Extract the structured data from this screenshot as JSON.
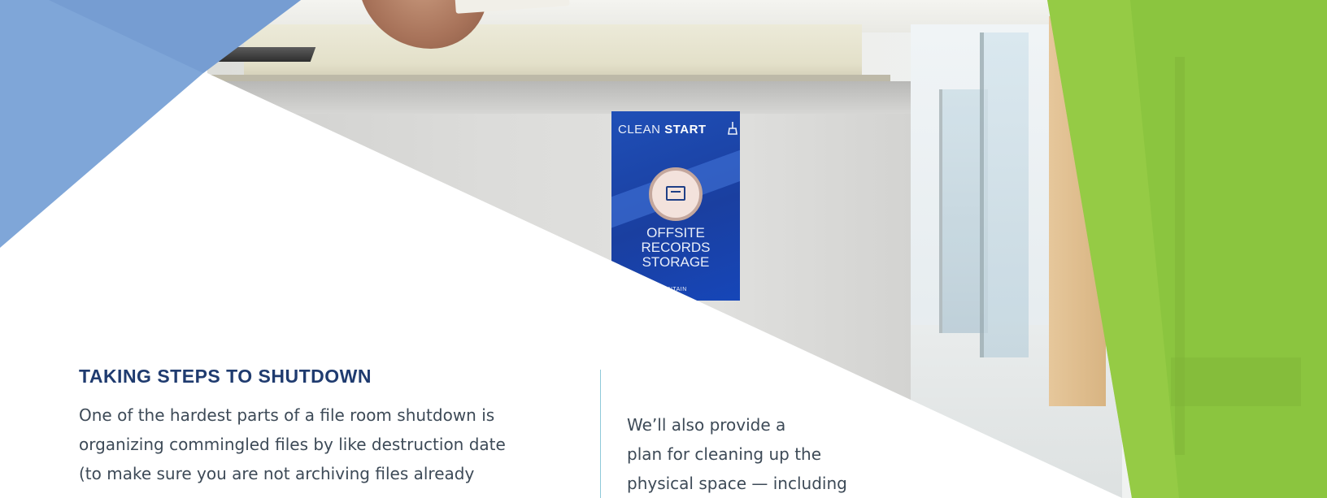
{
  "colors": {
    "heading": "#1f3b6f",
    "body": "#3d4a57",
    "accent_blue": "#6f9ad0",
    "accent_green": "#8bc53f",
    "divider": "#8fc9d9",
    "poster_blue": "#1f4fb7"
  },
  "photo": {
    "poster": {
      "brand_light": "CLEAN ",
      "brand_bold": "START",
      "icon": "broom-icon",
      "box_icon": "archive-box-icon",
      "title_lines": [
        "OFFSITE",
        "RECORDS",
        "STORAGE"
      ],
      "footer": "IRON MOUNTAIN"
    }
  },
  "section": {
    "heading": "TAKING STEPS TO SHUTDOWN",
    "left_lines": [
      "One of the hardest parts of a file room shutdown is",
      "organizing commingled files by like destruction date",
      "(to make sure you are not archiving files already"
    ],
    "right_lines": [
      "We’ll also provide a",
      "plan for cleaning up the",
      "physical space — including"
    ]
  }
}
